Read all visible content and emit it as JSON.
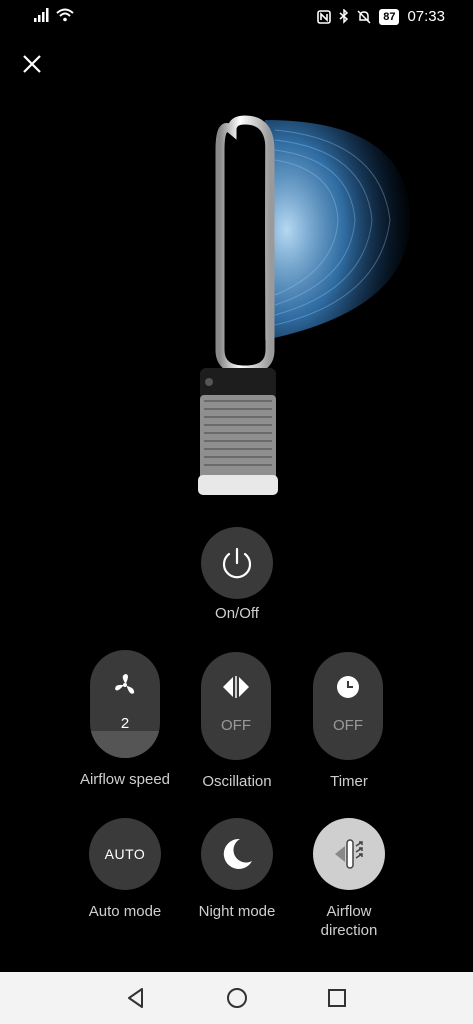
{
  "status_bar": {
    "battery": "87",
    "time": "07:33"
  },
  "controls": {
    "power": {
      "label": "On/Off"
    },
    "airflow_speed": {
      "label": "Airflow speed",
      "value": "2",
      "level": 0.25
    },
    "oscillation": {
      "label": "Oscillation",
      "value": "OFF"
    },
    "timer": {
      "label": "Timer",
      "value": "OFF"
    },
    "auto_mode": {
      "label": "Auto mode",
      "text": "AUTO"
    },
    "night_mode": {
      "label": "Night mode"
    },
    "airflow_direction": {
      "label_line1": "Airflow",
      "label_line2": "direction"
    }
  },
  "icons": {
    "close": "close-icon",
    "power": "power-icon",
    "fan": "fan-icon",
    "oscillation": "oscillation-icon",
    "timer": "clock-icon",
    "night": "moon-icon",
    "direction": "airflow-direction-icon"
  },
  "colors": {
    "background": "#000000",
    "button": "#3a3a3a",
    "airflow": "#5aa9e6"
  }
}
